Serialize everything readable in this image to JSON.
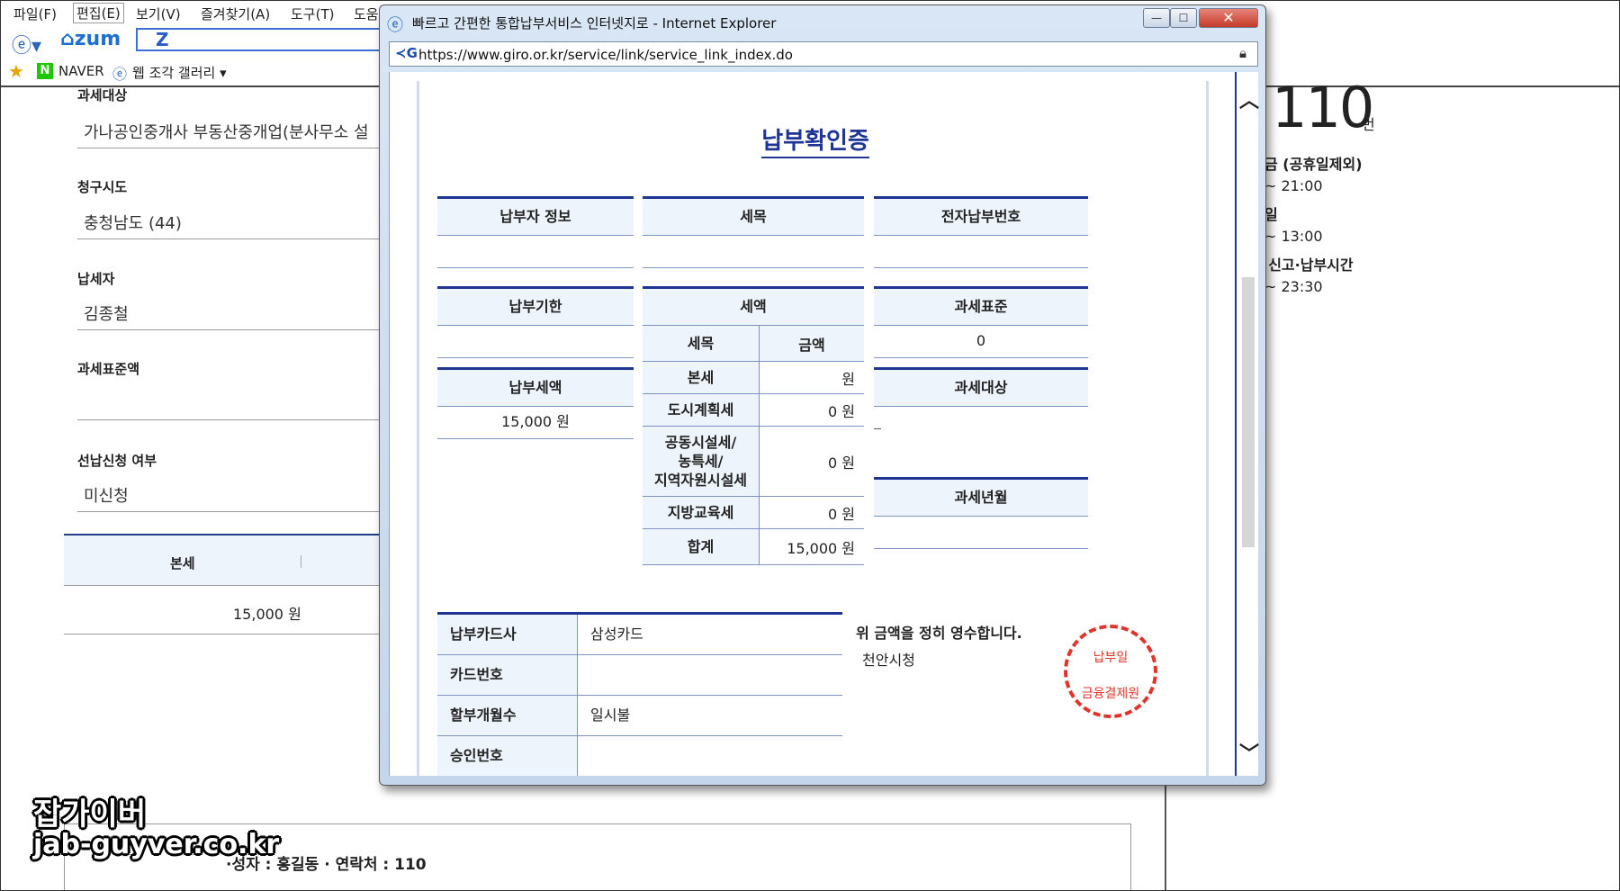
{
  "browser": {
    "menu": [
      "파일(F)",
      "편집(E)",
      "보기(V)",
      "즐겨찾기(A)",
      "도구(T)",
      "도움"
    ],
    "toolbar": {
      "zum": "zum",
      "z_label": "Z"
    },
    "favorites": {
      "naver_icon": "N",
      "naver": "NAVER",
      "gallery": "웹 조각 갤러리 ▾"
    }
  },
  "form": {
    "fields": [
      {
        "label": "과세대상",
        "value": "가나공인중개사 부동산중개업(분사무소 설"
      },
      {
        "label": "청구시도",
        "value": "충청남도 (44)"
      },
      {
        "label": "납세자",
        "value": "김종철"
      },
      {
        "label": "과세표준액",
        "value": ""
      },
      {
        "label": "선납신청 여부",
        "value": "미신청"
      }
    ],
    "tax_table": {
      "header": "본세",
      "value": "15,000 원"
    }
  },
  "right_panel": {
    "number": "110",
    "number_unit": "번",
    "lines": [
      "금 (공휴일제외)",
      "~ 21:00",
      "일",
      "~ 13:00",
      "- 신고·납부시간",
      "~ 23:30"
    ]
  },
  "bottom": {
    "contact": "·성자 : 홍길동 · 연락처 : 110"
  },
  "watermark": {
    "line1": "잡가이버",
    "line2": "jab-guyver.co.kr"
  },
  "popup": {
    "title": "빠르고 간편한 통합납부서비스 인터넷지로 - Internet Explorer",
    "url": "https://www.giro.or.kr/service/link/service_link_index.do",
    "controls": {
      "min": "—",
      "max": "☐",
      "close": "✕"
    },
    "doc": {
      "title": "납부확인증",
      "payer_info": {
        "label": "납부자 정보",
        "value": ""
      },
      "tax_item": {
        "label": "세목",
        "value": ""
      },
      "e_payment_no": {
        "label": "전자납부번호",
        "value": ""
      },
      "due_date": {
        "label": "납부기한",
        "value": ""
      },
      "paid_amount": {
        "label": "납부세액",
        "value": "15,000 원"
      },
      "tax_amount": {
        "label": "세액",
        "header": [
          "세목",
          "금액"
        ],
        "rows": [
          {
            "item": "본세",
            "amount": "원"
          },
          {
            "item": "도시계획세",
            "amount": "0 원"
          },
          {
            "item": "공동시설세/\n농특세/\n지역자원시설세",
            "amount": "0 원"
          },
          {
            "item": "지방교육세",
            "amount": "0 원"
          },
          {
            "item": "합계",
            "amount": "15,000 원"
          }
        ]
      },
      "tax_base": {
        "label": "과세표준",
        "value": "0"
      },
      "tax_object": {
        "label": "과세대상",
        "value": ""
      },
      "tax_year_month": {
        "label": "과세년월",
        "value": ""
      },
      "card": [
        {
          "key": "납부카드사",
          "value": "삼성카드"
        },
        {
          "key": "카드번호",
          "value": ""
        },
        {
          "key": "할부개월수",
          "value": "일시불"
        },
        {
          "key": "승인번호",
          "value": ""
        }
      ],
      "receipt_text": "위 금액을 정히 영수합니다.",
      "issuer": "천안시청",
      "stamp": {
        "line1": "납부일",
        "line2": "금융결제원"
      }
    }
  }
}
